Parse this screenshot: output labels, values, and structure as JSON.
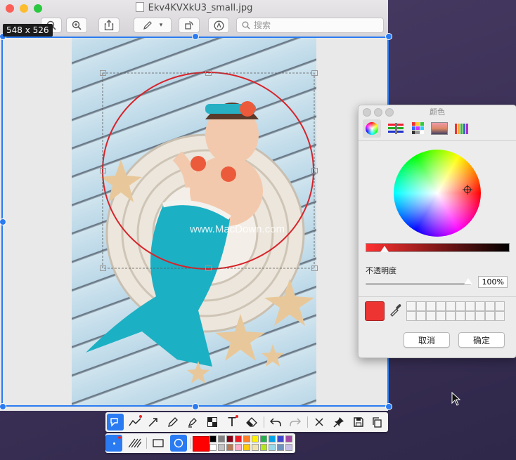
{
  "window": {
    "title": "Ekv4KVXkU3_small.jpg",
    "search_placeholder": "搜索",
    "selection_size": "548 x 526"
  },
  "color_panel": {
    "title": "颜色",
    "opacity_label": "不透明度",
    "opacity_value": "100%",
    "cancel_label": "取消",
    "ok_label": "确定",
    "current_color": "#ee3333",
    "tabs": [
      "color-wheel-icon",
      "color-sliders-icon",
      "color-palettes-icon",
      "image-palettes-icon",
      "pencils-icon"
    ]
  },
  "watermark": "www.MacDown.com",
  "annotation_toolbar": {
    "tools": [
      "select-icon",
      "line-chart-icon",
      "arrow-icon",
      "pencil-icon",
      "highlighter-icon",
      "mosaic-icon",
      "text-icon",
      "eraser-icon",
      "undo-icon",
      "redo-icon",
      "close-icon",
      "pin-icon",
      "save-icon",
      "copy-icon"
    ],
    "shape_options": [
      "dot-size-icon",
      "hatch-icon",
      "rectangle-icon",
      "ellipse-icon"
    ],
    "selected_color": "#ff0000",
    "palette": [
      "#000000",
      "#7f7f7f",
      "#880015",
      "#ed1c24",
      "#ff7f27",
      "#fff200",
      "#22b14c",
      "#00a2e8",
      "#3f48cc",
      "#a349a4",
      "#ffffff",
      "#c3c3c3",
      "#b97a57",
      "#ffaec9",
      "#ffc90e",
      "#efe4b0",
      "#b5e61d",
      "#99d9ea",
      "#7092be",
      "#c8bfe7"
    ]
  }
}
